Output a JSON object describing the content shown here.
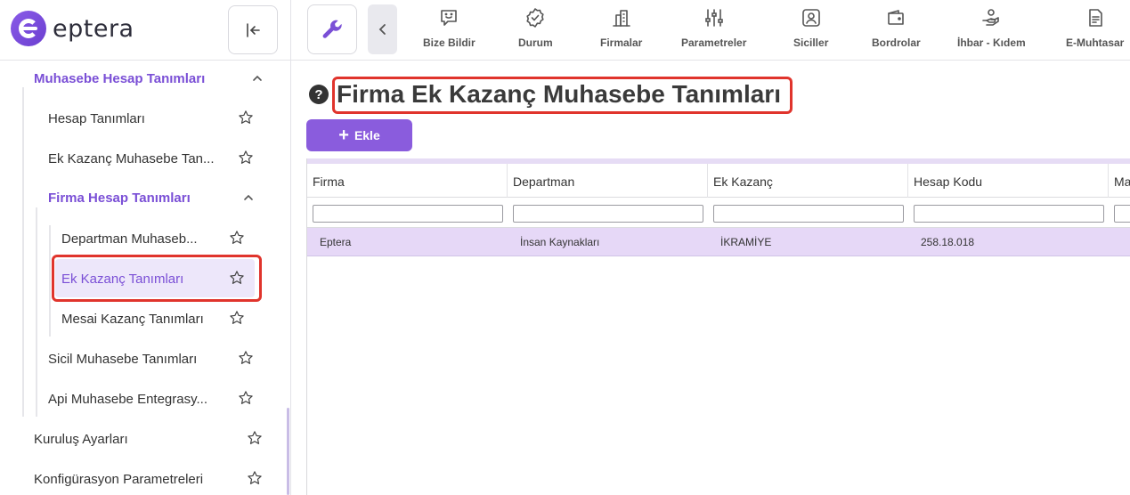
{
  "app": {
    "logo_text": "eptera"
  },
  "sidebar": {
    "items": [
      {
        "label": "Muhasebe Hesap Tanımları"
      },
      {
        "label": "Hesap Tanımları"
      },
      {
        "label": "Ek Kazanç Muhasebe Tan..."
      },
      {
        "label": "Firma Hesap Tanımları"
      },
      {
        "label": "Departman Muhaseb..."
      },
      {
        "label": "Ek Kazanç Tanımları"
      },
      {
        "label": "Mesai Kazanç Tanımları"
      },
      {
        "label": "Sicil Muhasebe Tanımları"
      },
      {
        "label": "Api Muhasebe Entegrasy..."
      },
      {
        "label": "Kuruluş Ayarları"
      },
      {
        "label": "Konfigürasyon Parametreleri"
      }
    ]
  },
  "topnav": {
    "items": [
      {
        "label": "Bize Bildir",
        "icon": "chat-smile-icon"
      },
      {
        "label": "Durum",
        "icon": "badge-check-icon"
      },
      {
        "label": "Firmalar",
        "icon": "building-icon"
      },
      {
        "label": "Parametreler",
        "icon": "sliders-icon"
      },
      {
        "label": "Siciller",
        "icon": "user-card-icon"
      },
      {
        "label": "Bordrolar",
        "icon": "wallet-icon"
      },
      {
        "label": "İhbar - Kıdem",
        "icon": "hand-coins-icon"
      },
      {
        "label": "E-Muhtasar",
        "icon": "document-icon"
      }
    ]
  },
  "page": {
    "title": "Firma Ek Kazanç Muhasebe Tanımları",
    "add_label": "Ekle"
  },
  "table": {
    "columns": [
      "Firma",
      "Departman",
      "Ek Kazanç",
      "Hesap Kodu",
      "Ma"
    ],
    "rows": [
      {
        "firma": "Eptera",
        "departman": "İnsan Kaynakları",
        "ek_kazanc": "İKRAMİYE",
        "hesap_kodu": "258.18.018"
      }
    ]
  },
  "colors": {
    "accent": "#8a5cdd",
    "highlight_border": "#e0342c",
    "selected_row": "#e6d8f7",
    "active_menu_text": "#7a4fd6"
  }
}
